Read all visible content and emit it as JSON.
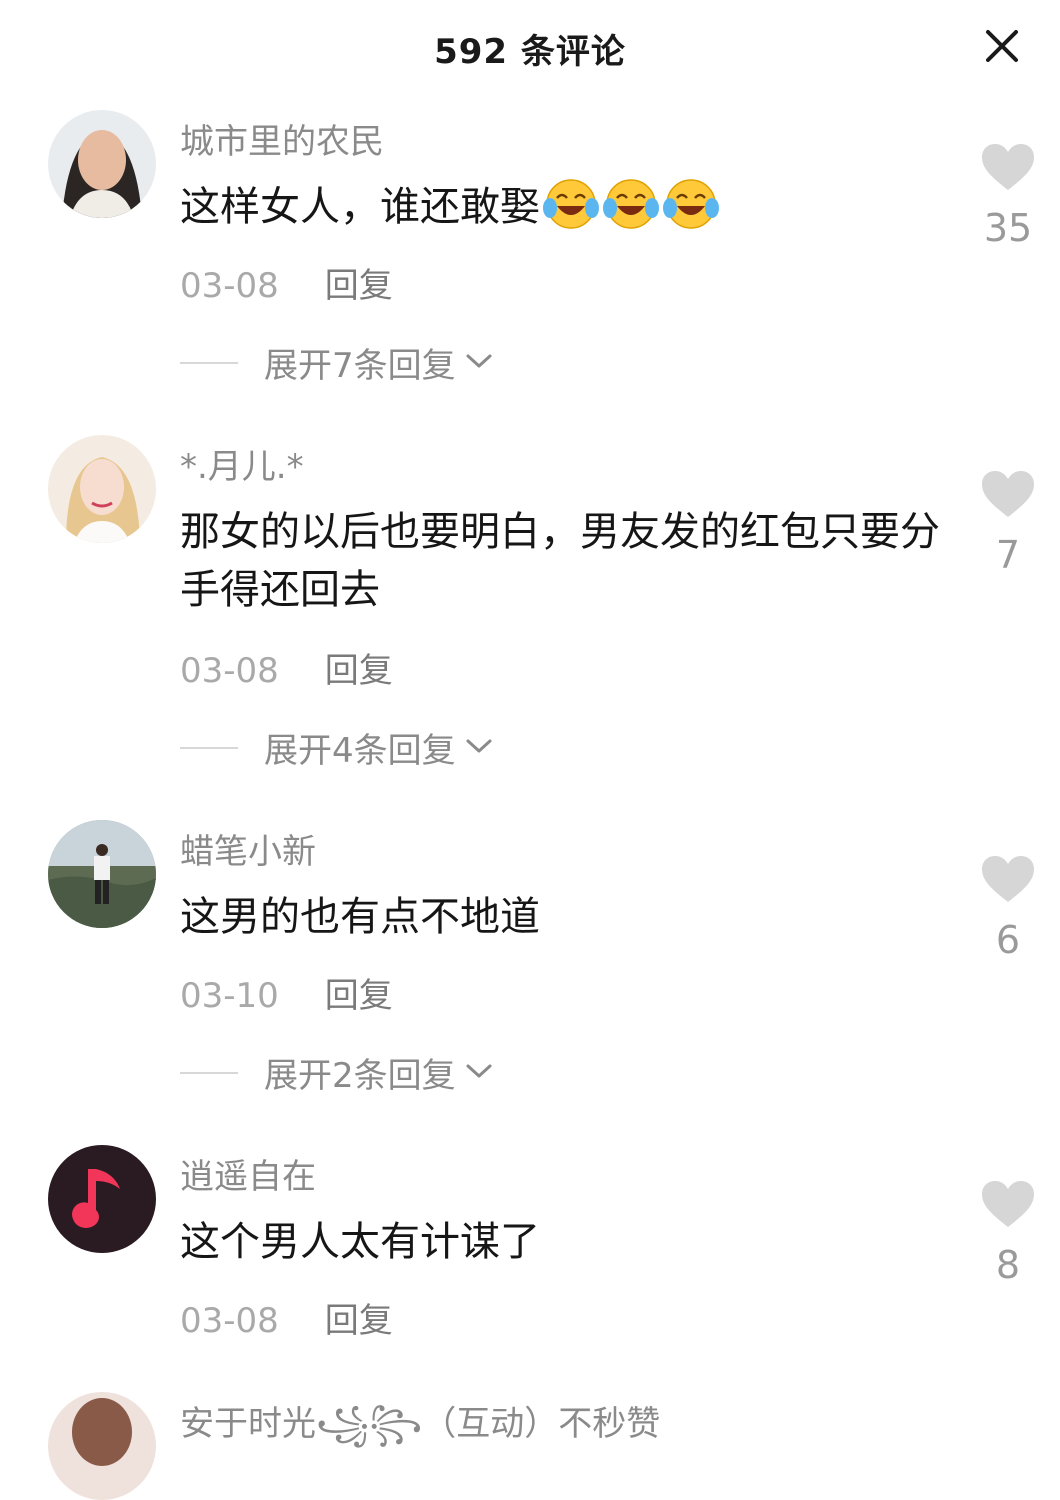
{
  "header": {
    "title": "592 条评论"
  },
  "comments": [
    {
      "username": "城市里的农民",
      "text": "这样女人，谁还敢娶",
      "emojis": [
        "laughing-crying-emoji",
        "laughing-crying-emoji",
        "laughing-crying-emoji"
      ],
      "date": "03-08",
      "reply_label": "回复",
      "expand_label": "展开7条回复",
      "likes": "35"
    },
    {
      "username": "*.月儿.*",
      "text": "那女的以后也要明白，男友发的红包只要分手得还回去",
      "date": "03-08",
      "reply_label": "回复",
      "expand_label": "展开4条回复",
      "likes": "7"
    },
    {
      "username": "蜡笔小新",
      "text": "这男的也有点不地道",
      "date": "03-10",
      "reply_label": "回复",
      "expand_label": "展开2条回复",
      "likes": "6"
    },
    {
      "username": "逍遥自在",
      "text": "这个男人太有计谋了",
      "date": "03-08",
      "reply_label": "回复",
      "likes": "8"
    },
    {
      "username": "安于时光꧁꧂（互动）不秒赞"
    }
  ],
  "colors": {
    "heart": "#d6d6d6",
    "music_logo_bg": "#2a1a22",
    "music_logo_note": "#f2365a"
  }
}
